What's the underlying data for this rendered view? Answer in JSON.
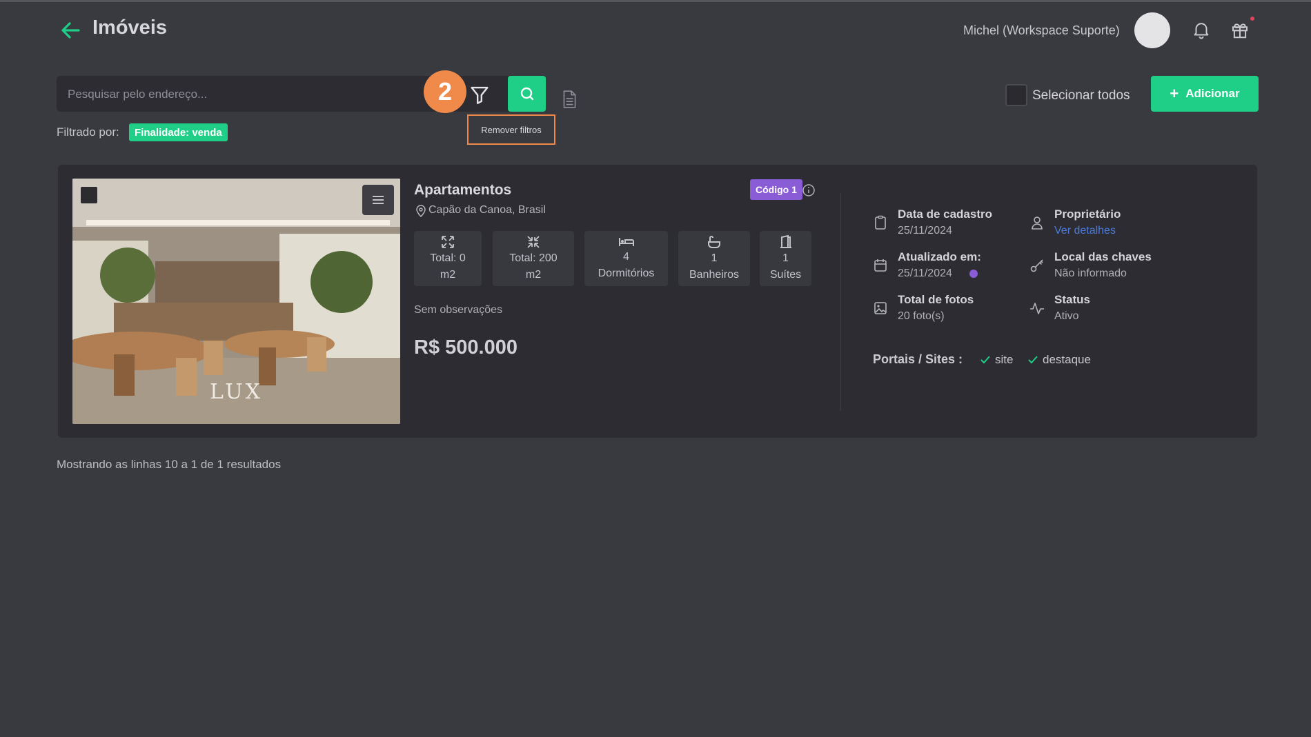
{
  "header": {
    "title": "Imóveis",
    "user_name": "Michel (Workspace Suporte)"
  },
  "search": {
    "placeholder": "Pesquisar pelo endereço...",
    "value": ""
  },
  "step_badge": "2",
  "tooltip": "Remover filtros",
  "select_all_label": "Selecionar todos",
  "add_button": {
    "plus": "+",
    "label": "Adicionar"
  },
  "filters": {
    "label": "Filtrado por:",
    "chips": [
      "Finalidade: venda"
    ]
  },
  "property": {
    "image_logo": "LUX",
    "type": "Apartamentos",
    "location": "Capão da Canoa, Brasil",
    "code": "Código 1",
    "features": [
      {
        "icon": "expand-icon",
        "value": "Total: 0",
        "unit": "m2"
      },
      {
        "icon": "compress-icon",
        "value": "Total: 200",
        "unit": "m2"
      },
      {
        "icon": "bed-icon",
        "value": "4",
        "unit": "Dormitórios"
      },
      {
        "icon": "bathtub-icon",
        "value": "1",
        "unit": "Banheiros"
      },
      {
        "icon": "door-icon",
        "value": "1",
        "unit": "Suítes"
      }
    ],
    "observations": "Sem observações",
    "price": "R$ 500.000",
    "meta": {
      "registered_label": "Data de cadastro",
      "registered_value": "25/11/2024",
      "owner_label": "Proprietário",
      "owner_link": "Ver detalhes",
      "updated_label": "Atualizado em:",
      "updated_value": "25/11/2024",
      "keys_label": "Local das chaves",
      "keys_value": "Não informado",
      "photos_label": "Total de fotos",
      "photos_value": "20 foto(s)",
      "status_label": "Status",
      "status_value": "Ativo"
    },
    "portals_label": "Portais / Sites :",
    "portals": [
      "site",
      "destaque"
    ]
  },
  "footer": "Mostrando as linhas 10 a 1 de 1 resultados",
  "colors": {
    "background": "#393940",
    "card": "#2c2c32",
    "accent_green": "#1fcf87",
    "accent_orange": "#f08a4b",
    "accent_purple": "#8a5cd6",
    "link_blue": "#4c7bd9"
  }
}
